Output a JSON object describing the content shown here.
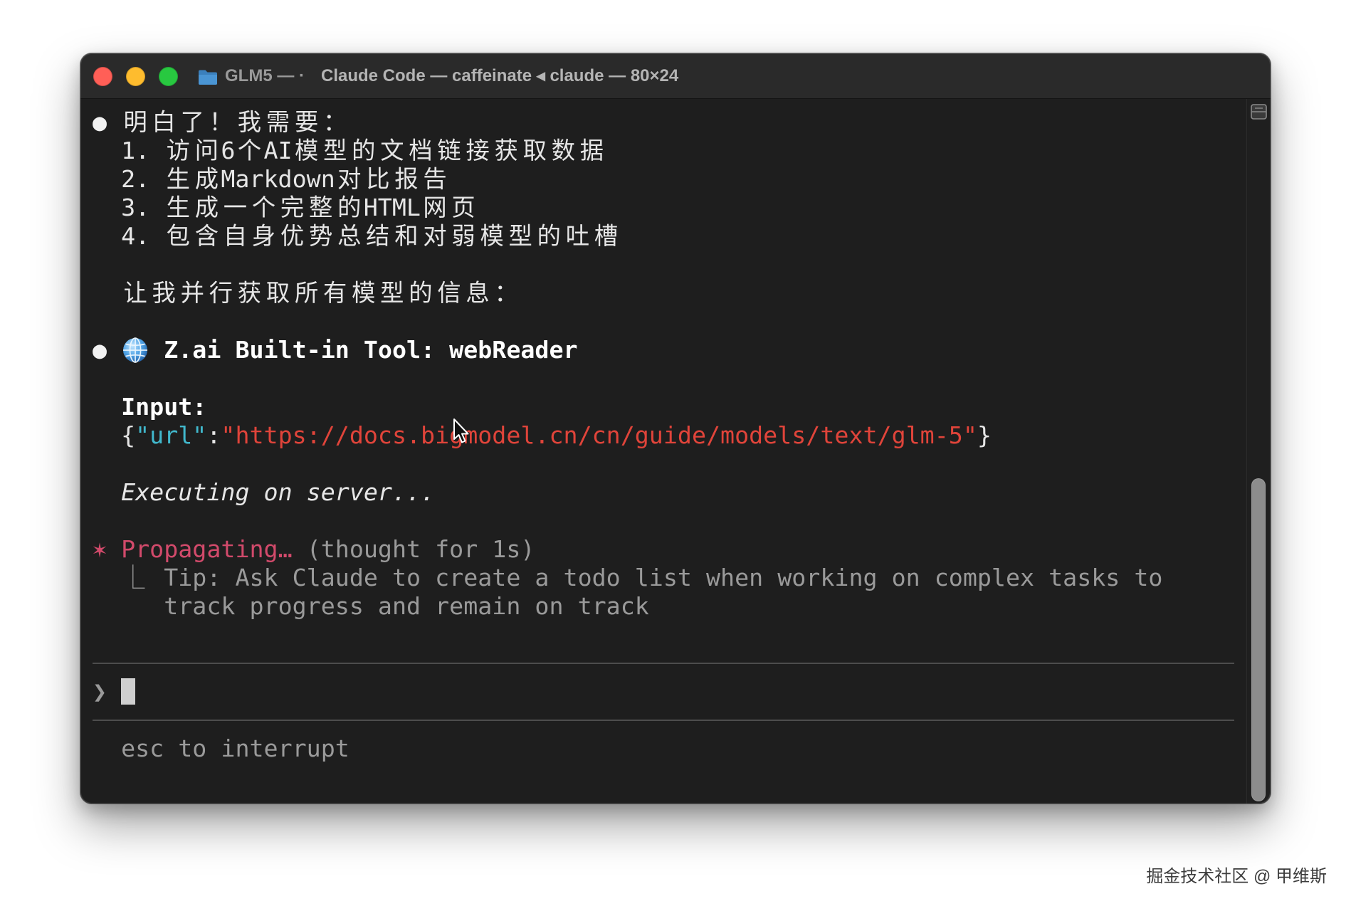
{
  "window": {
    "title_prefix": "GLM5 — ·",
    "title": "Claude Code — caffeinate ◂ claude — 80×24",
    "icon": "folder-icon",
    "colors": {
      "close": "#ff5f57",
      "minimize": "#febc2e",
      "zoom": "#28c840",
      "titlebar": "#2a2a2a",
      "background": "#1e1e1e"
    }
  },
  "terminal": {
    "assistant_message": {
      "bullet": "●",
      "heading": "明白了！我需要：",
      "steps": [
        "1. 访问6个AI模型的文档链接获取数据",
        "2. 生成Markdown对比报告",
        "3. 生成一个完整的HTML网页",
        "4. 包含自身优势总结和对弱模型的吐槽"
      ],
      "followup": "让我并行获取所有模型的信息："
    },
    "tool_call": {
      "bullet": "●",
      "icon": "globe-icon",
      "title": "Z.ai Built-in Tool: webReader",
      "input_label": "Input:",
      "input": {
        "open_brace": "{",
        "key": "\"url\"",
        "colon": ":",
        "value": "\"https://docs.bigmodel.cn/cn/guide/models/text/glm-5\"",
        "close_brace": "}"
      },
      "status": "Executing on server..."
    },
    "spinner": {
      "symbol": "✶",
      "verb": "Propagating…",
      "detail": "(thought for 1s)",
      "tip_marker": "⎿",
      "tip_lines": [
        "Tip: Ask Claude to create a todo list when working on complex tasks to",
        "track progress and remain on track"
      ]
    },
    "prompt": {
      "symbol": "❯",
      "value": ""
    },
    "hint": "esc to interrupt",
    "colors": {
      "text": "#e6e6e6",
      "json_key": "#41b8cc",
      "json_string": "#e0443a",
      "spinner": "#d24a6b",
      "dim": "#9a9a9a",
      "separator": "#4d4d4d"
    }
  },
  "scrollbar": {
    "icon": "split-pane-icon"
  },
  "pointer": {
    "icon": "mouse-pointer-icon"
  },
  "watermark": "掘金技术社区 @ 甲维斯"
}
